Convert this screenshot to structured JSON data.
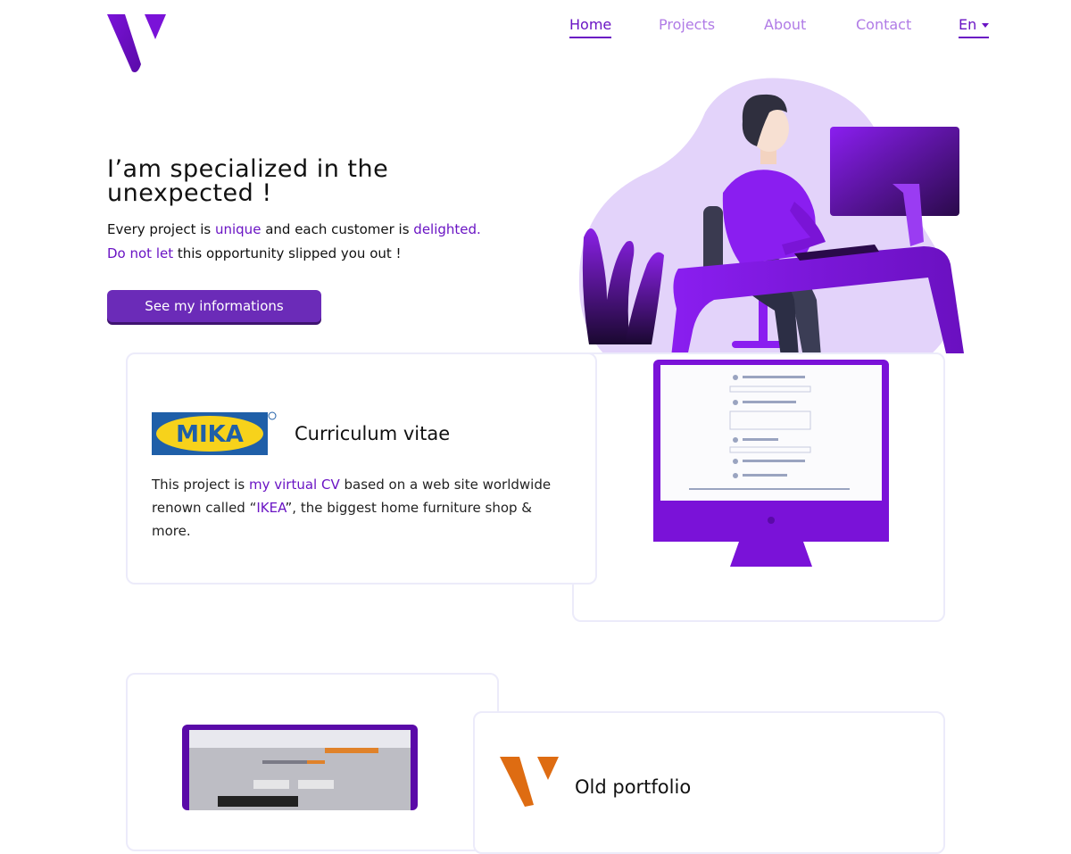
{
  "nav": {
    "items": [
      {
        "label": "Home",
        "active": true
      },
      {
        "label": "Projects",
        "active": false
      },
      {
        "label": "About",
        "active": false
      },
      {
        "label": "Contact",
        "active": false
      }
    ],
    "language": "En"
  },
  "hero": {
    "title": "I’am specialized in the unexpected !",
    "line1_a": "Every project is ",
    "line1_b": "unique",
    "line1_c": " and each customer is ",
    "line1_d": "delighted.",
    "line2_a": "Do not let",
    "line2_b": " this opportunity slipped you out !",
    "cta_label": "See my informations"
  },
  "projects": [
    {
      "logo_text": "MIKA",
      "title": "Curriculum vitae",
      "desc_a": "This project is ",
      "desc_b": "my virtual CV",
      "desc_c": " based on a web site worldwide renown called “",
      "desc_d": "IKEA",
      "desc_e": "”, the biggest home furniture shop & more."
    },
    {
      "title": "Old portfolio"
    }
  ],
  "colors": {
    "accent": "#6a14c4",
    "nav_inactive": "#b07be6",
    "button": "#6b2bb8",
    "card_border": "#ecebfa"
  },
  "icons": [
    "logo-v",
    "caret-down-icon",
    "person-at-desk-illustration",
    "monitor-mockup"
  ]
}
